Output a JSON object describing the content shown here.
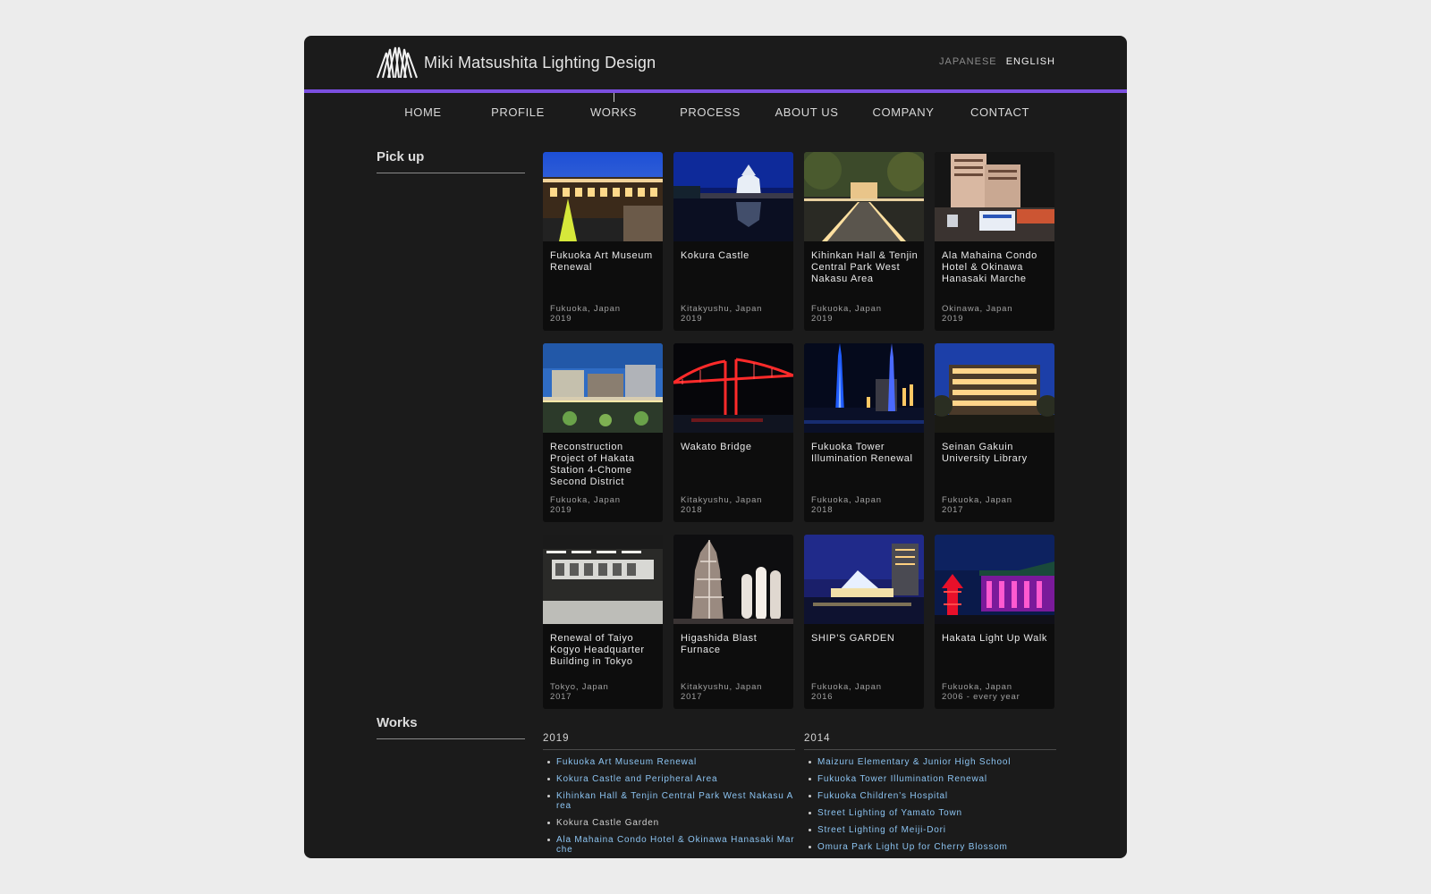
{
  "header": {
    "logo_text": "Miki Matsushita Lighting Design",
    "lang_japanese": "JAPANESE",
    "lang_english": "ENGLISH",
    "accent_color": "#7b4fe0"
  },
  "nav": [
    {
      "label": "HOME"
    },
    {
      "label": "PROFILE"
    },
    {
      "label": "WORKS",
      "active": true
    },
    {
      "label": "PROCESS"
    },
    {
      "label": "ABOUT US"
    },
    {
      "label": "COMPANY"
    },
    {
      "label": "CONTACT"
    }
  ],
  "sidebar": {
    "pickup_heading": "Pick up",
    "works_heading": "Works"
  },
  "pickup": [
    {
      "title": "Fukuoka Art Museum Renewal",
      "location": "Fukuoka, Japan",
      "year": "2019"
    },
    {
      "title": "Kokura Castle",
      "location": "Kitakyushu, Japan",
      "year": "2019"
    },
    {
      "title": "Kihinkan Hall & Tenjin Central Park West Nakasu Area",
      "location": "Fukuoka, Japan",
      "year": "2019"
    },
    {
      "title": "Ala Mahaina Condo Hotel & Okinawa Hanasaki Marche",
      "location": "Okinawa, Japan",
      "year": "2019"
    },
    {
      "title": "Reconstruction Project of Hakata Station 4-Chome Second District",
      "location": "Fukuoka, Japan",
      "year": "2019"
    },
    {
      "title": "Wakato Bridge",
      "location": "Kitakyushu, Japan",
      "year": "2018"
    },
    {
      "title": "Fukuoka Tower Illumination Renewal",
      "location": "Fukuoka, Japan",
      "year": "2018"
    },
    {
      "title": "Seinan Gakuin University Library",
      "location": "Fukuoka, Japan",
      "year": "2017"
    },
    {
      "title": "Renewal of Taiyo Kogyo Headquarter Building in Tokyo",
      "location": "Tokyo, Japan",
      "year": "2017"
    },
    {
      "title": "Higashida Blast Furnace",
      "location": "Kitakyushu, Japan",
      "year": "2017"
    },
    {
      "title": "SHIP’S GARDEN",
      "location": "Fukuoka, Japan",
      "year": "2016"
    },
    {
      "title": "Hakata Light Up Walk",
      "location": "Fukuoka, Japan",
      "year": "2006 - every year"
    }
  ],
  "works": [
    {
      "year": "2019",
      "items": [
        {
          "label": "Fukuoka Art Museum Renewal",
          "link": true
        },
        {
          "label": "Kokura Castle and Peripheral Area",
          "link": true
        },
        {
          "label": "Kihinkan Hall & Tenjin Central Park West Nakasu Area",
          "link": true
        },
        {
          "label": "Kokura Castle Garden",
          "link": false
        },
        {
          "label": "Ala Mahaina Condo Hotel & Okinawa Hanasaki Marche",
          "link": true
        }
      ]
    },
    {
      "year": "2014",
      "items": [
        {
          "label": "Maizuru Elementary & Junior High School",
          "link": true
        },
        {
          "label": "Fukuoka Tower Illumination Renewal",
          "link": true
        },
        {
          "label": "Fukuoka Children’s Hospital",
          "link": true
        },
        {
          "label": "Street Lighting of Yamato Town",
          "link": true
        },
        {
          "label": "Street Lighting of Meiji-Dori",
          "link": true
        },
        {
          "label": "Omura Park Light Up for Cherry Blossom",
          "link": true
        }
      ]
    }
  ]
}
